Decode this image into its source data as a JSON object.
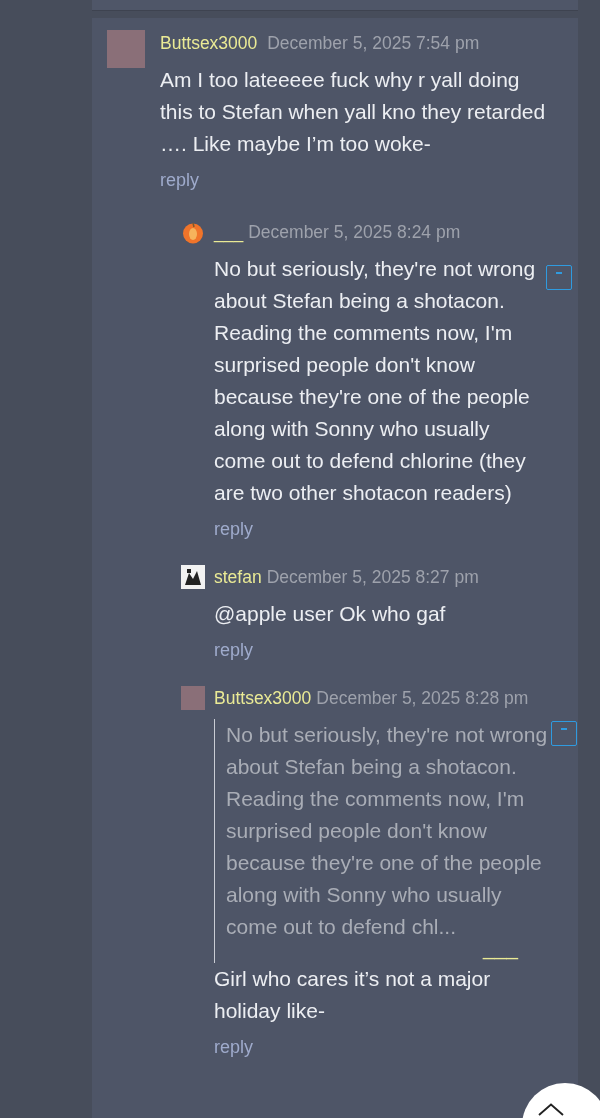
{
  "comments": [
    {
      "author": "Buttsex3000",
      "date": "December 5, 2025 7:54 pm",
      "kind": "picture",
      "text": "Am I too lateeeee fuck why r yall doing this to Stefan when yall kno they retarded …. Like maybe I’m too woke-",
      "reply": "reply",
      "children": [
        {
          "author": "___",
          "date": "December 5, 2025 8:24 pm",
          "kind": "fruit",
          "text": "No but seriously, they're not wrong about Stefan being a shotacon. Reading the comments now, I'm surprised people don't know because they're one of the people along with Sonny who usually come out to defend chlorine (they are two other shotacon readers)",
          "reply": "reply"
        },
        {
          "author": "stefan",
          "date": "December 5, 2025 8:27 pm",
          "kind": "sketch",
          "text": "@apple user Ok who gaf",
          "reply": "reply"
        },
        {
          "author": "Buttsex3000",
          "date": "December 5, 2025 8:28 pm",
          "kind": "picture",
          "quote": {
            "text": "No but seriously, they're not wrong about Stefan being a shotacon. Reading the comments now, I'm surprised people don't know because they're one of the people along with Sonny who usually come out to defend chl...",
            "author": "___"
          },
          "text": "Girl who cares it’s not a major holiday like-",
          "reply": "reply"
        }
      ]
    }
  ]
}
